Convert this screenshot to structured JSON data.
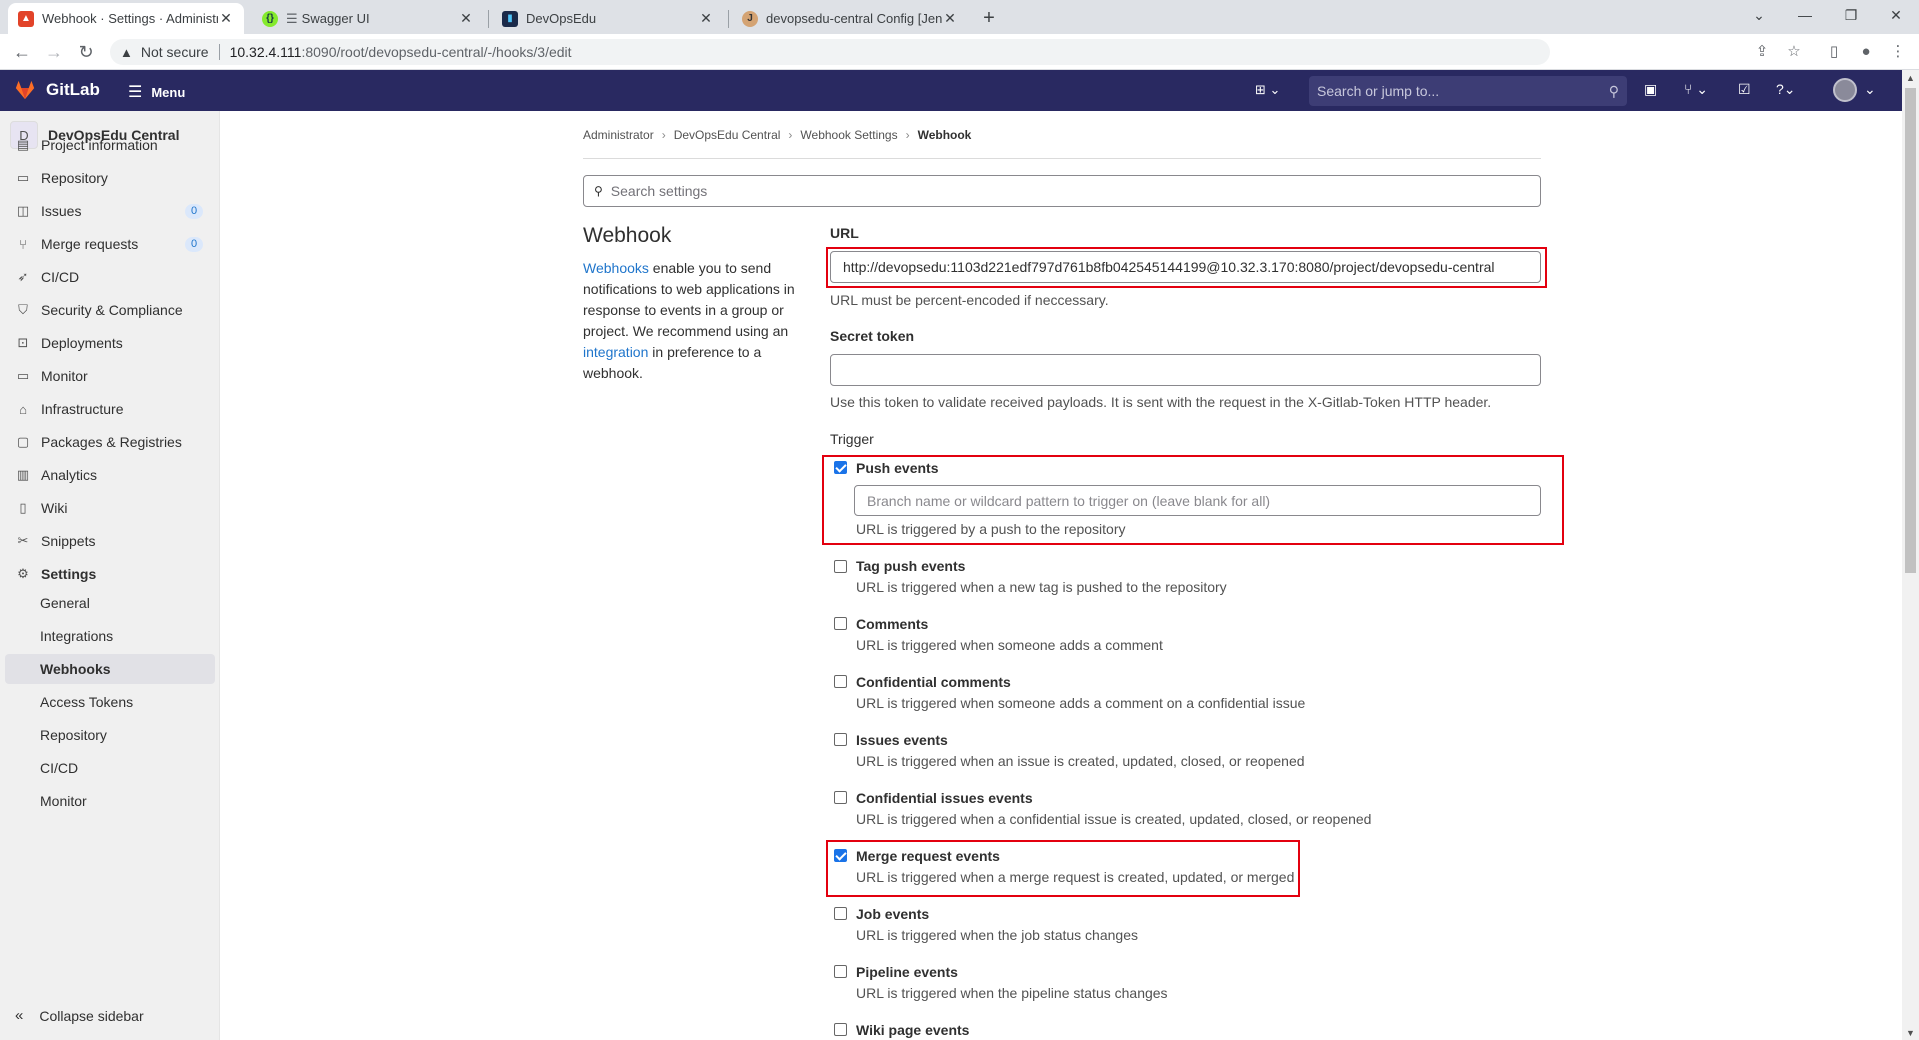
{
  "browser": {
    "tabs": [
      {
        "title": "Webhook · Settings · Administrat",
        "active": true
      },
      {
        "title": "Swagger UI",
        "active": false
      },
      {
        "title": "DevOpsEdu",
        "active": false
      },
      {
        "title": "devopsedu-central Config [Jenki",
        "active": false
      }
    ],
    "address": {
      "security_label": "Not secure",
      "url_host": "10.32.4.111",
      "url_rest": ":8090/root/devopsedu-central/-/hooks/3/edit"
    }
  },
  "gitlab_nav": {
    "brand": "GitLab",
    "menu_label": "Menu",
    "search_placeholder": "Search or jump to..."
  },
  "sidebar": {
    "project_initial": "D",
    "project_name": "DevOpsEdu Central",
    "items": [
      {
        "label": "Project information",
        "icon": "project-icon"
      },
      {
        "label": "Repository",
        "icon": "repository-icon"
      },
      {
        "label": "Issues",
        "icon": "issues-icon",
        "badge": "0"
      },
      {
        "label": "Merge requests",
        "icon": "merge-request-icon",
        "badge": "0"
      },
      {
        "label": "CI/CD",
        "icon": "rocket-icon"
      },
      {
        "label": "Security & Compliance",
        "icon": "shield-icon"
      },
      {
        "label": "Deployments",
        "icon": "deployments-icon"
      },
      {
        "label": "Monitor",
        "icon": "monitor-icon"
      },
      {
        "label": "Infrastructure",
        "icon": "infrastructure-icon"
      },
      {
        "label": "Packages & Registries",
        "icon": "package-icon"
      },
      {
        "label": "Analytics",
        "icon": "chart-icon"
      },
      {
        "label": "Wiki",
        "icon": "book-icon"
      },
      {
        "label": "Snippets",
        "icon": "scissors-icon"
      },
      {
        "label": "Settings",
        "icon": "gear-icon"
      }
    ],
    "settings_sub": [
      "General",
      "Integrations",
      "Webhooks",
      "Access Tokens",
      "Repository",
      "CI/CD",
      "Monitor"
    ],
    "active_sub": "Webhooks",
    "collapse_label": "Collapse sidebar"
  },
  "breadcrumb": [
    "Administrator",
    "DevOpsEdu Central",
    "Webhook Settings",
    "Webhook"
  ],
  "search_settings_placeholder": "Search settings",
  "left": {
    "title": "Webhook",
    "desc_link1": "Webhooks",
    "desc_part1": " enable you to send notifications to web applications in response to events in a group or project. We recommend using an ",
    "desc_link2": "integration",
    "desc_part2": " in preference to a webhook."
  },
  "form": {
    "url_label": "URL",
    "url_value": "http://devopsedu:1103d221edf797d761b8fb042545144199@10.32.3.170:8080/project/devopsedu-central",
    "url_help": "URL must be percent-encoded if neccessary.",
    "token_label": "Secret token",
    "token_value": "",
    "token_help": "Use this token to validate received payloads. It is sent with the request in the X-Gitlab-Token HTTP header.",
    "trigger_label": "Trigger",
    "push_branch_placeholder": "Branch name or wildcard pattern to trigger on (leave blank for all)",
    "events": [
      {
        "name": "Push events",
        "desc": "URL is triggered by a push to the repository",
        "checked": true
      },
      {
        "name": "Tag push events",
        "desc": "URL is triggered when a new tag is pushed to the repository",
        "checked": false
      },
      {
        "name": "Comments",
        "desc": "URL is triggered when someone adds a comment",
        "checked": false
      },
      {
        "name": "Confidential comments",
        "desc": "URL is triggered when someone adds a comment on a confidential issue",
        "checked": false
      },
      {
        "name": "Issues events",
        "desc": "URL is triggered when an issue is created, updated, closed, or reopened",
        "checked": false
      },
      {
        "name": "Confidential issues events",
        "desc": "URL is triggered when a confidential issue is created, updated, closed, or reopened",
        "checked": false
      },
      {
        "name": "Merge request events",
        "desc": "URL is triggered when a merge request is created, updated, or merged",
        "checked": true
      },
      {
        "name": "Job events",
        "desc": "URL is triggered when the job status changes",
        "checked": false
      },
      {
        "name": "Pipeline events",
        "desc": "URL is triggered when the pipeline status changes",
        "checked": false
      },
      {
        "name": "Wiki page events",
        "desc": "",
        "checked": false
      }
    ]
  },
  "colors": {
    "gitlab_nav": "#292961",
    "link": "#1f75cb",
    "highlight_box": "#e3000f",
    "checkbox_checked": "#1a73e8"
  }
}
